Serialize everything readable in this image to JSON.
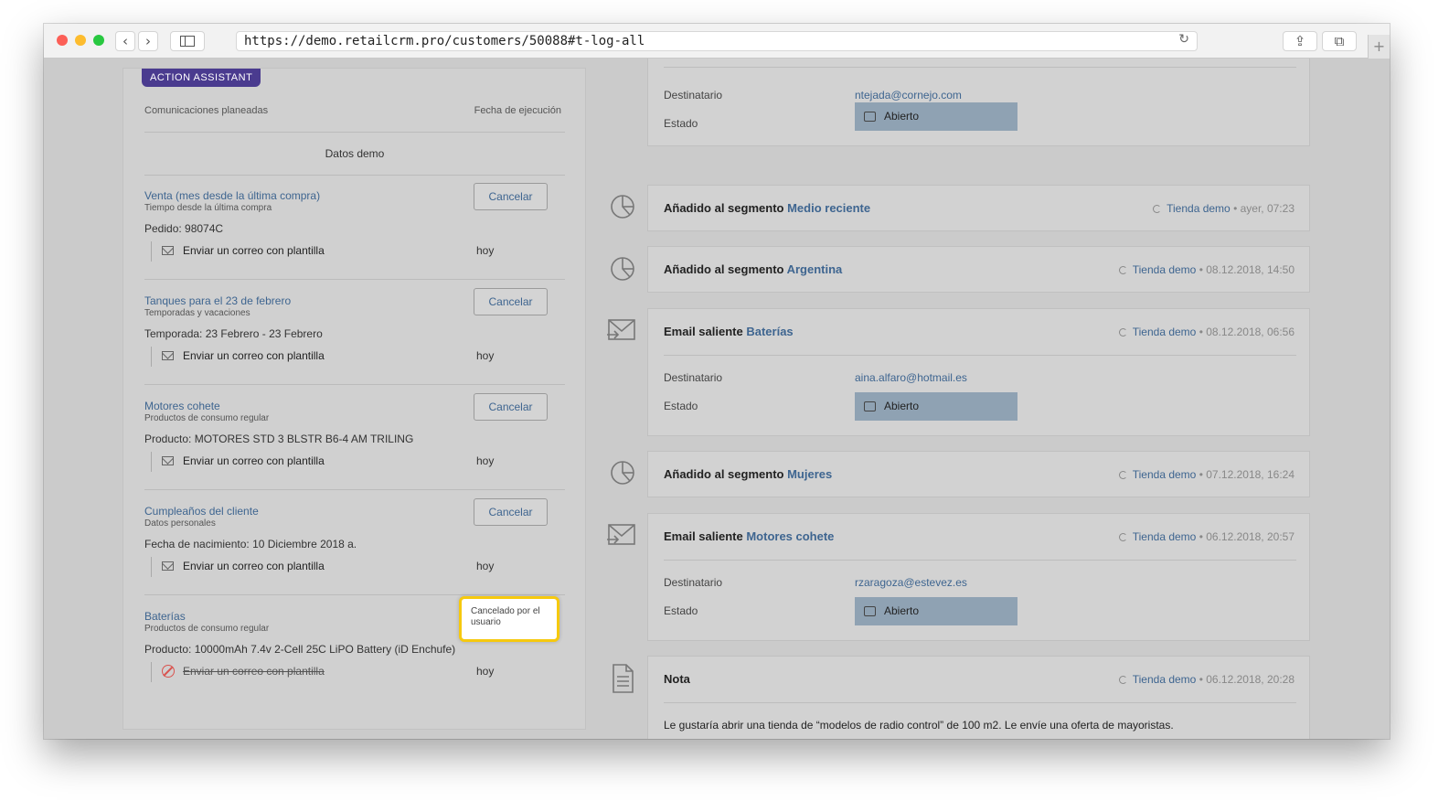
{
  "browser": {
    "url": "https://demo.retailcrm.pro/customers/50088#t-log-all",
    "back": "‹",
    "forward": "›",
    "reload": "↻",
    "share": "⇪",
    "tabs": "⧉",
    "new_tab": "+"
  },
  "assistant": {
    "badge": "ACTION ASSISTANT",
    "col_left": "Comunicaciones planeadas",
    "col_right": "Fecha de ejecución",
    "section_title": "Datos demo",
    "items": [
      {
        "title": "Venta (mes desde la última compra)",
        "subtitle": "Tiempo desde la última compra",
        "detail": "Pedido: 98074C",
        "button": "Cancelar",
        "action": "Enviar un correo con plantilla",
        "when": "hoy"
      },
      {
        "title": "Tanques para el 23 de febrero",
        "subtitle": "Temporadas y vacaciones",
        "detail": "Temporada: 23 Febrero - 23 Febrero",
        "button": "Cancelar",
        "action": "Enviar un correo con plantilla",
        "when": "hoy"
      },
      {
        "title": "Motores cohete",
        "subtitle": "Productos de consumo regular",
        "detail": "Producto: MOTORES STD 3 BLSTR B6-4 AM TRILING",
        "button": "Cancelar",
        "action": "Enviar un correo con plantilla",
        "when": "hoy"
      },
      {
        "title": "Cumpleaños del cliente",
        "subtitle": "Datos personales",
        "detail": "Fecha de nacimiento: 10 Diciembre 2018 a.",
        "button": "Cancelar",
        "action": "Enviar un correo con plantilla",
        "when": "hoy"
      },
      {
        "title": "Baterías",
        "subtitle": "Productos de consumo regular",
        "detail": "Producto: 10000mAh 7.4v 2-Cell 25C LiPO Battery (iD Enchufe)",
        "status": "Cancelado por el usuario",
        "action": "Enviar un correo con plantilla",
        "when": "hoy"
      }
    ]
  },
  "timeline": {
    "labels": {
      "recipient": "Destinatario",
      "state": "Estado"
    },
    "top_partial": {
      "recipient": "ntejada@cornejo.com",
      "state": "Abierto"
    },
    "events": [
      {
        "prefix": "Añadido al segmento",
        "link": "Medio reciente",
        "shop": "Tienda demo",
        "time": "• ayer, 07:23"
      },
      {
        "prefix": "Añadido al segmento",
        "link": "Argentina",
        "shop": "Tienda demo",
        "time": "• 08.12.2018, 14:50"
      },
      {
        "prefix": "Email saliente",
        "link": "Baterías",
        "shop": "Tienda demo",
        "time": "• 08.12.2018, 06:56",
        "recipient": "aina.alfaro@hotmail.es",
        "state": "Abierto"
      },
      {
        "prefix": "Añadido al segmento",
        "link": "Mujeres",
        "shop": "Tienda demo",
        "time": "• 07.12.2018, 16:24"
      },
      {
        "prefix": "Email saliente",
        "link": "Motores cohete",
        "shop": "Tienda demo",
        "time": "• 06.12.2018, 20:57",
        "recipient": "rzaragoza@estevez.es",
        "state": "Abierto"
      },
      {
        "prefix": "Nota",
        "link": "",
        "shop": "Tienda demo",
        "time": "• 06.12.2018, 20:28",
        "text": "Le gustaría abrir una tienda de “modelos de radio control” de 100 m2. Le envíe una oferta de mayoristas."
      }
    ]
  }
}
